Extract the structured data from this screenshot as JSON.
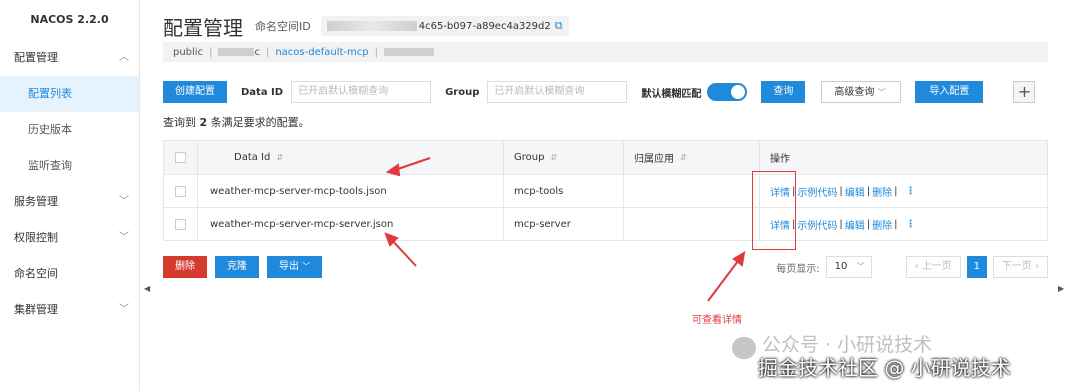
{
  "brand": "NACOS 2.2.0",
  "sidebar": {
    "items": [
      {
        "label": "配置管理"
      },
      {
        "label": "配置列表"
      },
      {
        "label": "历史版本"
      },
      {
        "label": "监听查询"
      },
      {
        "label": "服务管理"
      },
      {
        "label": "权限控制"
      },
      {
        "label": "命名空间"
      },
      {
        "label": "集群管理"
      }
    ]
  },
  "header": {
    "title": "配置管理",
    "namespace_label": "命名空间ID",
    "namespace_id_visible": "4c65-b097-a89ec4a329d2"
  },
  "ns_bar": {
    "public": "public",
    "pipe": "|",
    "partial": "c",
    "default_mcp": "nacos-default-mcp"
  },
  "toolbar": {
    "create_label": "创建配置",
    "dataid_label": "Data ID",
    "dataid_placeholder": "已开启默认模糊查询",
    "group_label": "Group",
    "group_placeholder": "已开启默认模糊查询",
    "fuzzy_label": "默认模糊匹配",
    "query_label": "查询",
    "advanced_label": "高级查询",
    "import_label": "导入配置",
    "plus": "+"
  },
  "result": {
    "prefix": "查询到",
    "count": "2",
    "suffix": "条满足要求的配置。"
  },
  "table": {
    "headers": {
      "dataid": "Data Id",
      "group": "Group",
      "app": "归属应用",
      "op": "操作"
    },
    "rows": [
      {
        "dataid": "weather-mcp-server-mcp-tools.json",
        "group": "mcp-tools",
        "app": ""
      },
      {
        "dataid": "weather-mcp-server-mcp-server.json",
        "group": "mcp-server",
        "app": ""
      }
    ],
    "ops": {
      "detail": "详情",
      "sample": "示例代码",
      "edit": "编辑",
      "delete": "删除",
      "sep": "|",
      "more": "⋮"
    }
  },
  "bottom": {
    "delete_label": "删除",
    "clone_label": "克隆",
    "export_label": "导出",
    "page_size_label": "每页显示:",
    "page_size": "10",
    "prev_label": "上一页",
    "current_page": "1",
    "next_label": "下一页"
  },
  "annotation": {
    "text": "可查看详情",
    "color": "#e0393e"
  },
  "watermarks": {
    "wechat": "公众号 · 小研说技术",
    "juejin": "掘金技术社区 @ 小研说技术"
  },
  "colors": {
    "primary": "#1f89db",
    "danger": "#d63a2f",
    "annotation": "#e0393e"
  }
}
